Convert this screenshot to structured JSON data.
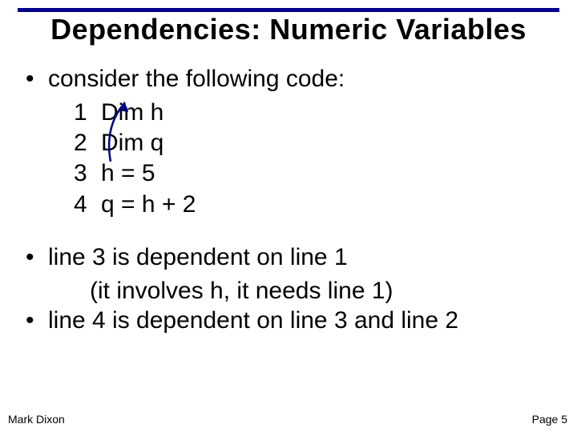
{
  "title": "Dependencies: Numeric Variables",
  "bullets": {
    "intro": "consider the following code:",
    "dep1": "line 3 is dependent on line 1",
    "dep1_sub": "(it involves h, it needs line 1)",
    "dep2": "line 4 is dependent on line 3 and line 2"
  },
  "code": {
    "n1": "1",
    "l1": "Dim h",
    "n2": "2",
    "l2": "Dim q",
    "n3": "3",
    "l3": " h = 5",
    "n4": "4",
    "l4": " q = h + 2"
  },
  "footer": {
    "author": "Mark Dixon",
    "page": "Page 5"
  },
  "colors": {
    "rule": "#00008b",
    "arrow": "#000080"
  }
}
